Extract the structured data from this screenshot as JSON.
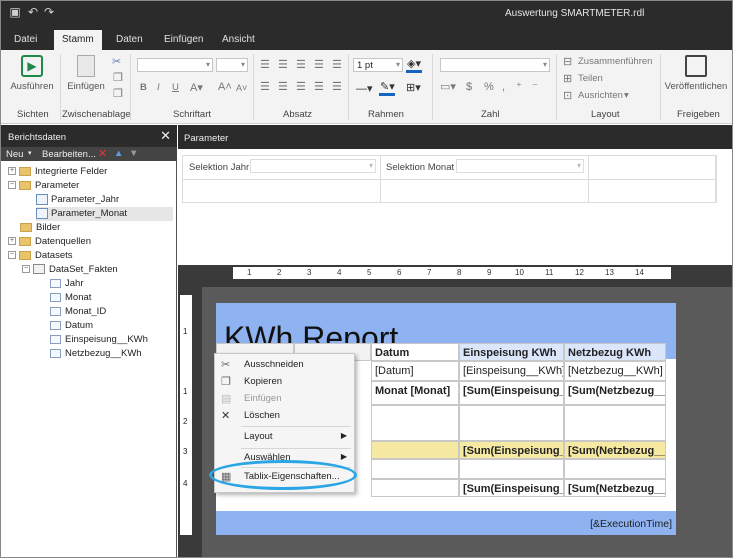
{
  "window": {
    "title": "Auswertung SMARTMETER.rdl"
  },
  "ribbon": {
    "tabs": [
      "Datei",
      "Stamm",
      "Daten",
      "Einfügen",
      "Ansicht"
    ],
    "active_tab": "Stamm",
    "groups": {
      "sichten": "Sichten",
      "zwischenablage": "Zwischenablage",
      "schriftart": "Schriftart",
      "absatz": "Absatz",
      "rahmen": "Rahmen",
      "zahl": "Zahl",
      "layout": "Layout",
      "freigeben": "Freigeben"
    },
    "buttons": {
      "ausfuehren": "Ausführen",
      "einfuegen": "Einfügen",
      "border_width": "1 pt",
      "zusammenfuehren": "Zusammenführen",
      "teilen": "Teilen",
      "ausrichten": "Ausrichten",
      "veroeffentlichen": "Veröffentlichen",
      "bold": "B",
      "italic": "I",
      "underline": "U"
    }
  },
  "report_data": {
    "title": "Berichtsdaten",
    "toolbar": {
      "neu": "Neu",
      "bearbeiten": "Bearbeiten..."
    },
    "tree": {
      "integrierte_felder": "Integrierte Felder",
      "parameter": "Parameter",
      "parameter_jahr": "Parameter_Jahr",
      "parameter_monat": "Parameter_Monat",
      "bilder": "Bilder",
      "datenquellen": "Datenquellen",
      "datasets": "Datasets",
      "dataset_fakten": "DataSet_Fakten",
      "fields": [
        "Jahr",
        "Monat",
        "Monat_ID",
        "Datum",
        "Einspeisung__KWh",
        "Netzbezug__KWh"
      ]
    }
  },
  "parameters": {
    "title": "Parameter",
    "selektion_jahr": "Selektion Jahr",
    "selektion_monat": "Selektion Monat"
  },
  "ruler": [
    "1",
    "2",
    "3",
    "4",
    "5",
    "6",
    "7",
    "8",
    "9",
    "10",
    "11",
    "12",
    "13",
    "14"
  ],
  "vruler": [
    "1",
    "1",
    "2",
    "3",
    "4"
  ],
  "report": {
    "title": "KWh Report",
    "headers": {
      "datum": "Datum",
      "einspeisung": "Einspeisung KWh",
      "netzbezug": "Netzbezug KWh"
    },
    "row1": {
      "datum": "[Datum]",
      "einspeisung": "[Einspeisung__KWh]",
      "netzbezug": "[Netzbezug__KWh]"
    },
    "row2": {
      "datum": "Monat [Monat]",
      "einspeisung": "[Sum(Einspeisung__",
      "netzbezug": "[Sum(Netzbezug__"
    },
    "row3": {
      "einspeisung": "[Sum(Einspeisung__",
      "netzbezug": "[Sum(Netzbezug__"
    },
    "row4": {
      "einspeisung": "[Sum(Einspeisung__",
      "netzbezug": "[Sum(Netzbezug__"
    },
    "footer": "[&ExecutionTime]"
  },
  "context_menu": {
    "ausschneiden": "Ausschneiden",
    "kopieren": "Kopieren",
    "einfuegen": "Einfügen",
    "loeschen": "Löschen",
    "layout": "Layout",
    "auswaehlen": "Auswählen",
    "tablix": "Tablix-Eigenschaften..."
  }
}
